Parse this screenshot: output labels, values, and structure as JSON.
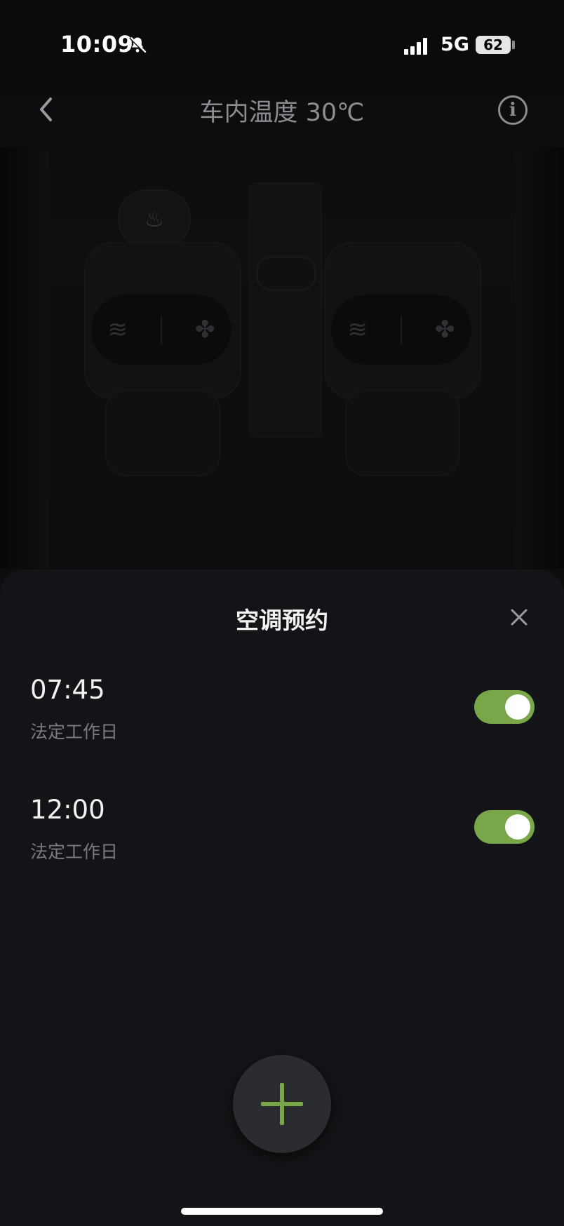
{
  "status_bar": {
    "time": "10:09",
    "network": "5G",
    "battery": "62",
    "icons": [
      "bell-slash-icon",
      "signal-icon",
      "battery-icon"
    ]
  },
  "header": {
    "title": "车内温度 30℃",
    "icons": [
      "chevron-left-icon",
      "info-icon"
    ]
  },
  "scene": {
    "seat_controls": [
      "seat-heat-icon",
      "fan-icon"
    ],
    "steering_icon": "steering-heat-icon"
  },
  "sheet": {
    "title": "空调预约",
    "schedules": [
      {
        "time": "07:45",
        "repeat": "法定工作日",
        "enabled": true
      },
      {
        "time": "12:00",
        "repeat": "法定工作日",
        "enabled": true
      }
    ]
  },
  "colors": {
    "accent": "#7aa64a",
    "background": "#0d0e10",
    "sheet": "#131417",
    "muted_text": "#7a7b80"
  }
}
